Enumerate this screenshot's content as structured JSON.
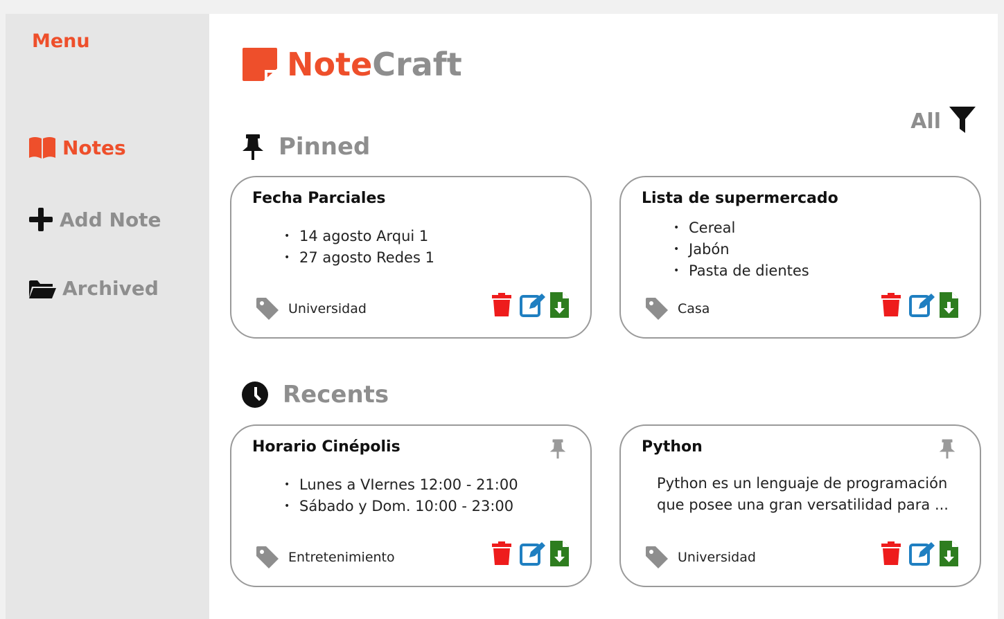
{
  "sidebar": {
    "title": "Menu",
    "items": [
      {
        "label": "Notes",
        "icon": "book-open-icon",
        "active": true
      },
      {
        "label": "Add Note",
        "icon": "plus-icon",
        "active": false
      },
      {
        "label": "Archived",
        "icon": "folder-open-icon",
        "active": false
      }
    ]
  },
  "logo": {
    "part1": "Note",
    "part2": "Craft"
  },
  "filter": {
    "label": "All",
    "icon": "filter-icon"
  },
  "sections": {
    "pinned": {
      "title": "Pinned",
      "icon": "pin-icon"
    },
    "recents": {
      "title": "Recents",
      "icon": "clock-icon"
    }
  },
  "pinned_notes": [
    {
      "title": "Fecha Parciales",
      "items": [
        "14 agosto Arqui 1",
        "27 agosto Redes 1"
      ],
      "tag": "Universidad"
    },
    {
      "title": "Lista de supermercado",
      "items": [
        "Cereal",
        "Jabón",
        "Pasta de dientes"
      ],
      "tag": "Casa"
    }
  ],
  "recent_notes": [
    {
      "title": "Horario Cinépolis",
      "items": [
        "Lunes a VIernes 12:00 - 21:00",
        "Sábado y Dom. 10:00 - 23:00"
      ],
      "tag": "Entretenimiento"
    },
    {
      "title": "Python",
      "text": "Python es un lenguaje de programación que posee una gran versatilidad para ...",
      "tag": "Universidad"
    }
  ],
  "colors": {
    "accent": "#ee4f2b",
    "muted": "#8e8e8e",
    "delete": "#ee1c1c",
    "edit": "#1f7fc1",
    "download": "#2e7d1f"
  }
}
